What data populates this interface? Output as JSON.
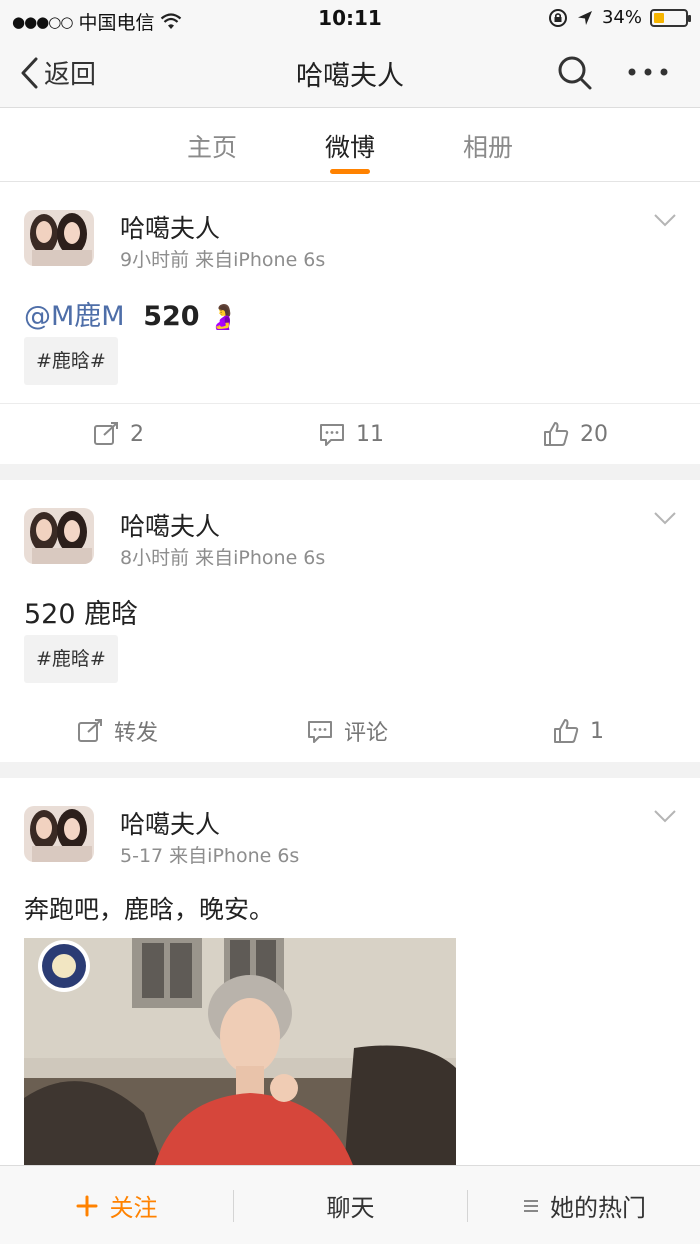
{
  "status_bar": {
    "carrier": "中国电信",
    "time": "10:11",
    "battery_percent": "34%",
    "battery_level": 0.34,
    "signal_icon": "signal-dots-icon",
    "wifi_icon": "wifi-icon",
    "lock_icon": "rotation-lock-icon",
    "location_icon": "location-arrow-icon"
  },
  "nav": {
    "back_label": "返回",
    "title": "哈噶夫人"
  },
  "tabs": [
    {
      "label": "主页",
      "active": false
    },
    {
      "label": "微博",
      "active": true
    },
    {
      "label": "相册",
      "active": false
    }
  ],
  "posts": [
    {
      "author": "哈噶夫人",
      "meta": "9小时前  来自iPhone 6s",
      "mention": "@M鹿M",
      "text": "520",
      "emoji": "🤰",
      "hashtag": "#鹿晗#",
      "actions": {
        "repost": "2",
        "comment": "11",
        "like": "20"
      }
    },
    {
      "author": "哈噶夫人",
      "meta": "8小时前  来自iPhone 6s",
      "text": "520 鹿晗",
      "hashtag": "#鹿晗#",
      "actions": {
        "repost": "转发",
        "comment": "评论",
        "like": "1"
      }
    },
    {
      "author": "哈噶夫人",
      "meta": "5-17  来自iPhone 6s",
      "text": "奔跑吧，鹿晗，晚安。"
    }
  ],
  "bottom_bar": {
    "follow": "关注",
    "chat": "聊天",
    "hot": "她的热门"
  },
  "colors": {
    "accent": "#ff8200",
    "mention": "#4e6ea8"
  }
}
